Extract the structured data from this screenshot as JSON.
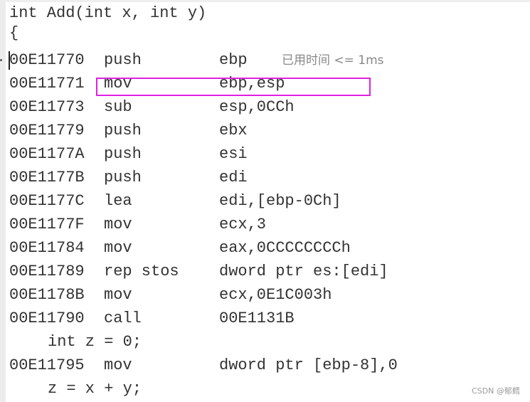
{
  "source_header": [
    "int Add(int x, int y)",
    "{"
  ],
  "elapsed_hint": "已用时间 <= 1ms",
  "rows": [
    {
      "type": "asm",
      "address": "00E11770",
      "mnemonic": "push",
      "operands": "ebp"
    },
    {
      "type": "asm",
      "address": "00E11771",
      "mnemonic": "mov",
      "operands": "ebp,esp"
    },
    {
      "type": "asm",
      "address": "00E11773",
      "mnemonic": "sub",
      "operands": "esp,0CCh"
    },
    {
      "type": "asm",
      "address": "00E11779",
      "mnemonic": "push",
      "operands": "ebx"
    },
    {
      "type": "asm",
      "address": "00E1177A",
      "mnemonic": "push",
      "operands": "esi"
    },
    {
      "type": "asm",
      "address": "00E1177B",
      "mnemonic": "push",
      "operands": "edi"
    },
    {
      "type": "asm",
      "address": "00E1177C",
      "mnemonic": "lea",
      "operands": "edi,[ebp-0Ch]"
    },
    {
      "type": "asm",
      "address": "00E1177F",
      "mnemonic": "mov",
      "operands": "ecx,3"
    },
    {
      "type": "asm",
      "address": "00E11784",
      "mnemonic": "mov",
      "operands": "eax,0CCCCCCCCh"
    },
    {
      "type": "asm",
      "address": "00E11789",
      "mnemonic": "rep stos",
      "operands": "dword ptr es:[edi]"
    },
    {
      "type": "asm",
      "address": "00E1178B",
      "mnemonic": "mov",
      "operands": "ecx,0E1C003h"
    },
    {
      "type": "asm",
      "address": "00E11790",
      "mnemonic": "call",
      "operands": "00E1131B"
    },
    {
      "type": "src",
      "text": "int z = 0;"
    },
    {
      "type": "asm",
      "address": "00E11795",
      "mnemonic": "mov",
      "operands": "dword ptr [ebp-8],0"
    },
    {
      "type": "src",
      "text": "z = x + y;"
    }
  ],
  "highlight_color": "#e020e0",
  "watermark": "CSDN @郁鳕"
}
